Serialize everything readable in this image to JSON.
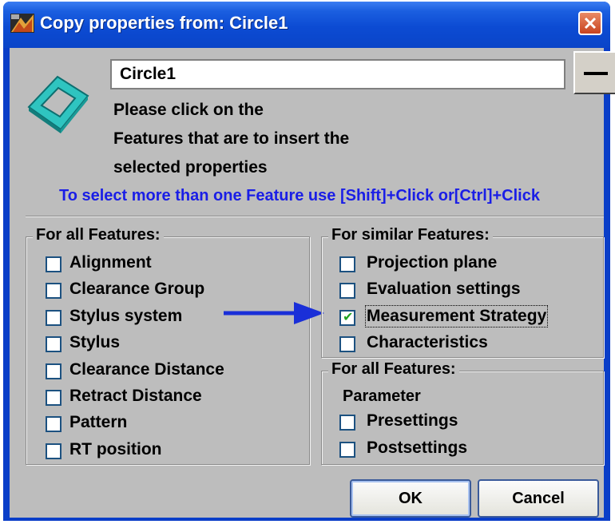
{
  "window": {
    "title": "Copy properties from: Circle1",
    "close_symbol": "✕"
  },
  "header": {
    "feature_icon": "circle-feature-icon",
    "name_value": "Circle1",
    "minus_button_icon": "minus-icon"
  },
  "instruction": {
    "line1": "Please click on the",
    "line2": "Features that are to insert the",
    "line3": "selected properties",
    "hint": "To select more than one Feature use [Shift]+Click or[Ctrl]+Click",
    "hint_color": "#1a1ee6"
  },
  "left_group": {
    "legend": "For all Features:",
    "items": [
      {
        "label": "Alignment",
        "checked": false
      },
      {
        "label": "Clearance Group",
        "checked": false
      },
      {
        "label": "Stylus system",
        "checked": false
      },
      {
        "label": "Stylus",
        "checked": false
      },
      {
        "label": "Clearance Distance",
        "checked": false
      },
      {
        "label": "Retract Distance",
        "checked": false
      },
      {
        "label": "Pattern",
        "checked": false
      },
      {
        "label": "RT position",
        "checked": false
      }
    ]
  },
  "similar_group": {
    "legend": "For similar Features:",
    "items": [
      {
        "label": "Projection plane",
        "checked": false
      },
      {
        "label": "Evaluation settings",
        "checked": false
      },
      {
        "label": "Measurement Strategy",
        "checked": true
      },
      {
        "label": "Characteristics",
        "checked": false
      }
    ]
  },
  "param_group": {
    "legend": "For all Features:",
    "parameter_label": "Parameter",
    "items": [
      {
        "label": "Presettings",
        "checked": false
      },
      {
        "label": "Postsettings",
        "checked": false
      }
    ]
  },
  "annotation": {
    "arrow_color": "#1a2fd8"
  },
  "buttons": {
    "ok": "OK",
    "cancel": "Cancel"
  },
  "colors": {
    "titlebar": "#0c4bd3",
    "dialog_bg": "#bdbdbd",
    "close_button": "#d55a34"
  }
}
